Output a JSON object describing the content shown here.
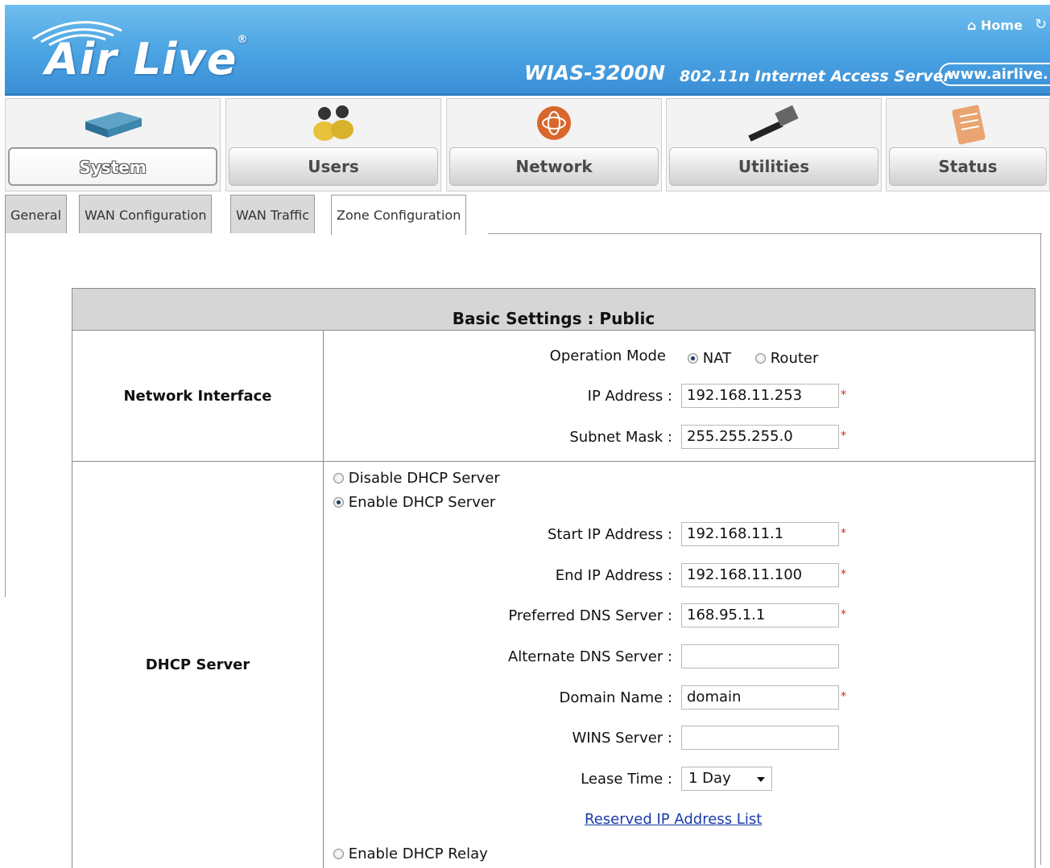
{
  "header": {
    "logo": "Air Live",
    "logo_reg": "®",
    "home": "Home",
    "model": "WIAS-3200N",
    "subtitle": "802.11n Internet Access Server",
    "website": "www.airlive."
  },
  "nav": {
    "items": [
      {
        "label": "System",
        "icon": "router-icon",
        "active": true
      },
      {
        "label": "Users",
        "icon": "users-icon"
      },
      {
        "label": "Network",
        "icon": "globe-icon"
      },
      {
        "label": "Utilities",
        "icon": "hammer-icon"
      },
      {
        "label": "Status",
        "icon": "document-icon"
      }
    ]
  },
  "tabs": [
    "General",
    "WAN Configuration",
    "WAN Traffic",
    "Zone Configuration"
  ],
  "active_tab": "Zone Configuration",
  "section_title": "Basic Settings : Public",
  "network_interface": {
    "label": "Network Interface",
    "operation_mode_label": "Operation Mode",
    "mode_nat": "NAT",
    "mode_router": "Router",
    "ip_label": "IP Address :",
    "ip_value": "192.168.11.253",
    "mask_label": "Subnet Mask :",
    "mask_value": "255.255.255.0"
  },
  "dhcp": {
    "label": "DHCP Server",
    "disable": "Disable DHCP Server",
    "enable": "Enable DHCP Server",
    "start_label": "Start IP Address :",
    "start_value": "192.168.11.1",
    "end_label": "End IP Address :",
    "end_value": "192.168.11.100",
    "dns1_label": "Preferred DNS Server :",
    "dns1_value": "168.95.1.1",
    "dns2_label": "Alternate DNS Server :",
    "dns2_value": "",
    "domain_label": "Domain Name :",
    "domain_value": "domain",
    "wins_label": "WINS Server :",
    "wins_value": "",
    "lease_label": "Lease Time :",
    "lease_value": "1 Day",
    "reserved_link": "Reserved IP Address List",
    "relay": "Enable DHCP Relay"
  },
  "required_mark": "*",
  "colors": {
    "header_blue": "#4aa3e2",
    "link": "#1a3aa8",
    "required": "#e02020"
  }
}
